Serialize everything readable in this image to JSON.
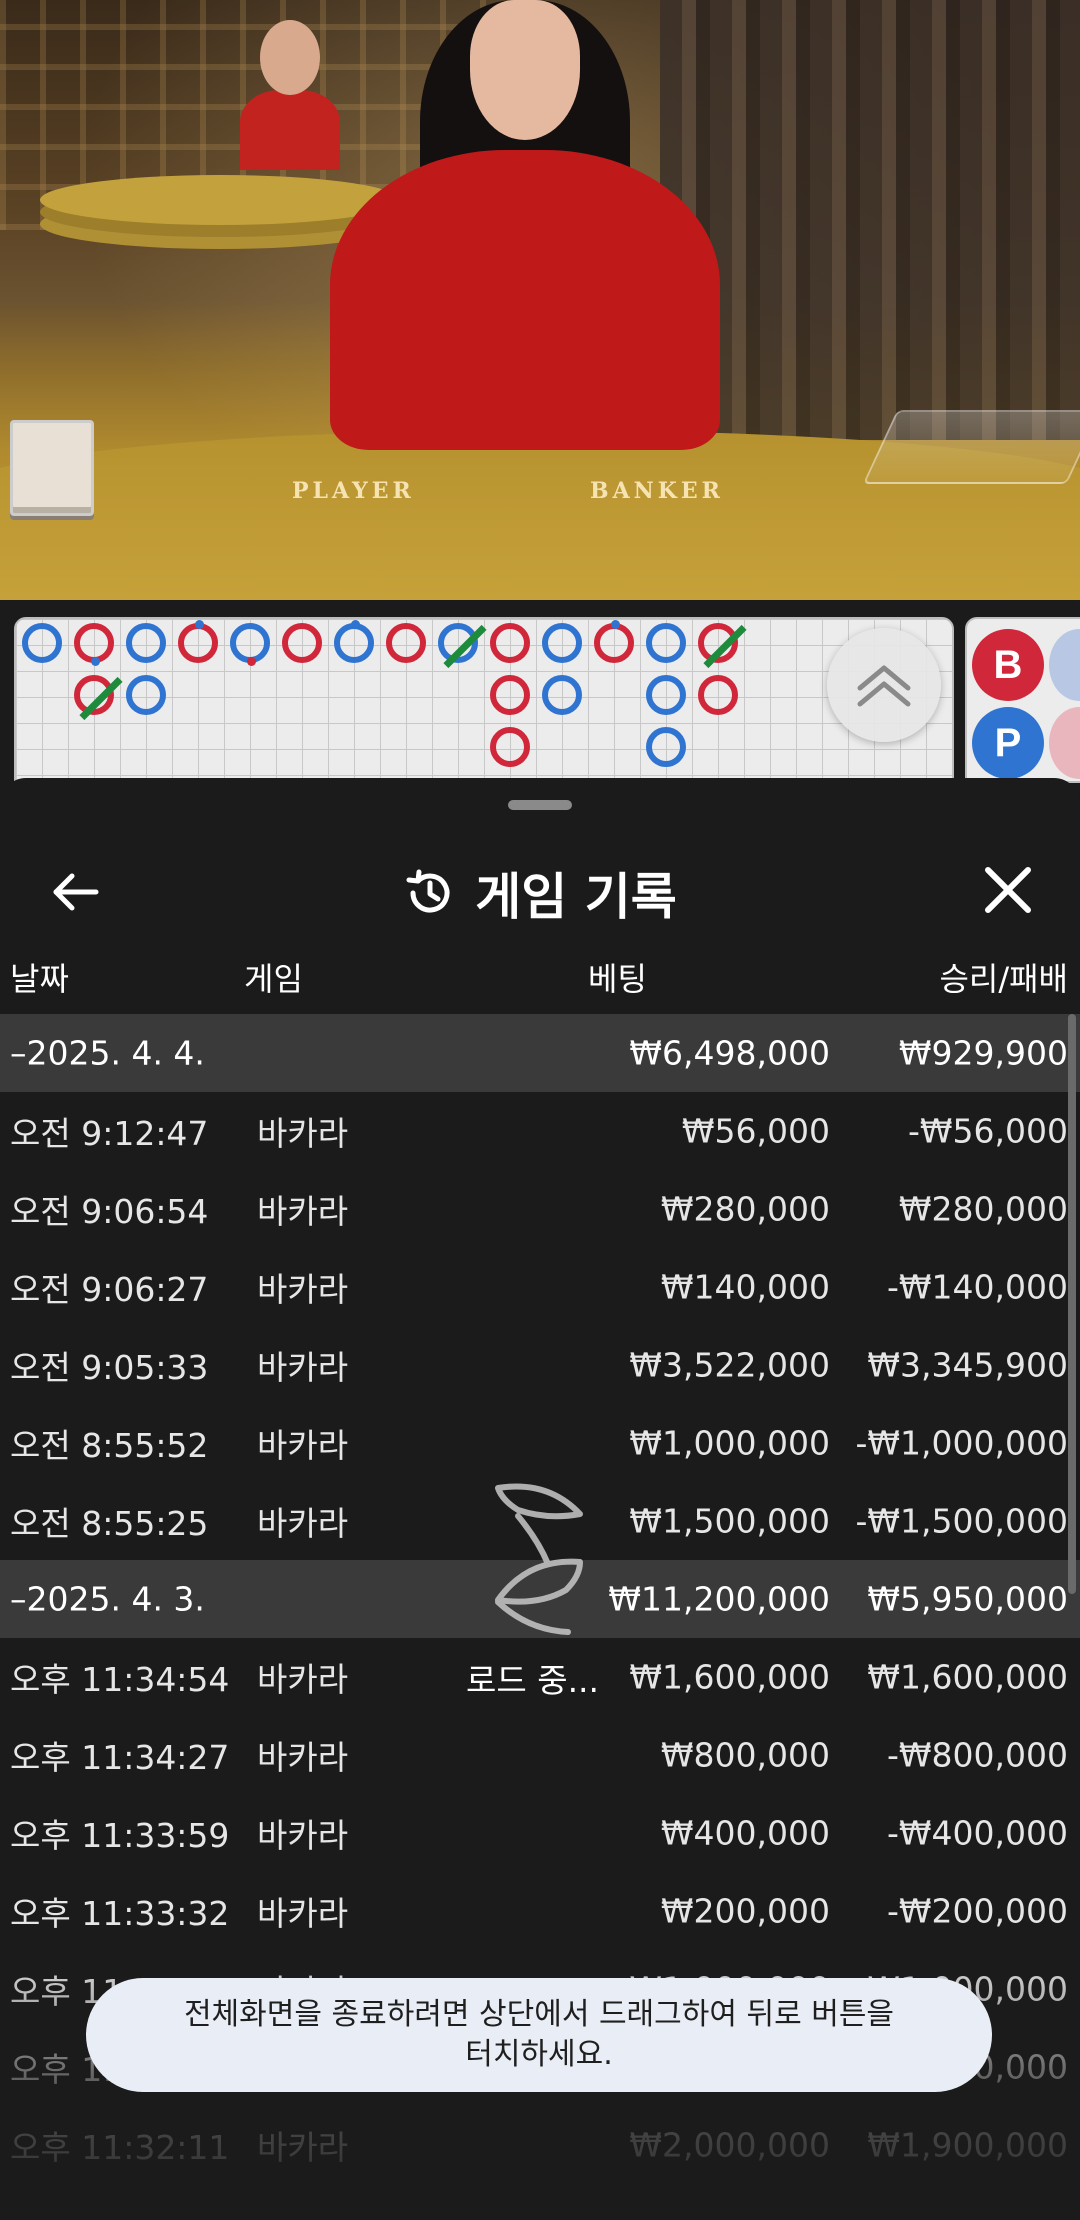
{
  "video": {
    "table_labels": {
      "player": "PLAYER",
      "banker": "BANKER"
    }
  },
  "road": {
    "beads": [
      {
        "col": 0,
        "row": 0,
        "color": "blue"
      },
      {
        "col": 1,
        "row": 0,
        "color": "red",
        "dot": "blue-bottom"
      },
      {
        "col": 1,
        "row": 1,
        "color": "red",
        "slash": true
      },
      {
        "col": 2,
        "row": 0,
        "color": "blue"
      },
      {
        "col": 2,
        "row": 1,
        "color": "blue"
      },
      {
        "col": 3,
        "row": 0,
        "color": "red",
        "dot": "blue"
      },
      {
        "col": 4,
        "row": 0,
        "color": "blue",
        "dot": "red-bottom"
      },
      {
        "col": 5,
        "row": 0,
        "color": "red"
      },
      {
        "col": 6,
        "row": 0,
        "color": "blue",
        "dot": "blue"
      },
      {
        "col": 7,
        "row": 0,
        "color": "red"
      },
      {
        "col": 8,
        "row": 0,
        "color": "blue",
        "slash": true
      },
      {
        "col": 9,
        "row": 0,
        "color": "red"
      },
      {
        "col": 9,
        "row": 1,
        "color": "red"
      },
      {
        "col": 9,
        "row": 2,
        "color": "red"
      },
      {
        "col": 10,
        "row": 0,
        "color": "blue"
      },
      {
        "col": 10,
        "row": 1,
        "color": "blue"
      },
      {
        "col": 11,
        "row": 0,
        "color": "red",
        "dot": "blue"
      },
      {
        "col": 12,
        "row": 0,
        "color": "blue"
      },
      {
        "col": 12,
        "row": 1,
        "color": "blue"
      },
      {
        "col": 12,
        "row": 2,
        "color": "blue"
      },
      {
        "col": 13,
        "row": 0,
        "color": "red",
        "slash": true
      },
      {
        "col": 13,
        "row": 1,
        "color": "red"
      }
    ],
    "side_buttons": {
      "banker": "B",
      "player": "P"
    }
  },
  "sheet": {
    "title": "게임 기록",
    "columns": {
      "date": "날짜",
      "game": "게임",
      "bet": "베팅",
      "winloss": "승리/패배"
    },
    "rows": [
      {
        "type": "group",
        "time": "–2025. 4. 4.",
        "game": "",
        "bet": "₩6,498,000",
        "win": "₩929,900"
      },
      {
        "type": "item",
        "time": "오전 9:12:47",
        "game": "바카라",
        "bet": "₩56,000",
        "win": "-₩56,000"
      },
      {
        "type": "item",
        "time": "오전 9:06:54",
        "game": "바카라",
        "bet": "₩280,000",
        "win": "₩280,000"
      },
      {
        "type": "item",
        "time": "오전 9:06:27",
        "game": "바카라",
        "bet": "₩140,000",
        "win": "-₩140,000"
      },
      {
        "type": "item",
        "time": "오전 9:05:33",
        "game": "바카라",
        "bet": "₩3,522,000",
        "win": "₩3,345,900"
      },
      {
        "type": "item",
        "time": "오전 8:55:52",
        "game": "바카라",
        "bet": "₩1,000,000",
        "win": "-₩1,000,000"
      },
      {
        "type": "item",
        "time": "오전 8:55:25",
        "game": "바카라",
        "bet": "₩1,500,000",
        "win": "-₩1,500,000"
      },
      {
        "type": "group",
        "time": "–2025. 4. 3.",
        "game": "",
        "bet": "₩11,200,000",
        "win": "₩5,950,000"
      },
      {
        "type": "item",
        "time": "오후 11:34:54",
        "game": "바카라",
        "bet": "₩1,600,000",
        "win": "₩1,600,000"
      },
      {
        "type": "item",
        "time": "오후 11:34:27",
        "game": "바카라",
        "bet": "₩800,000",
        "win": "-₩800,000"
      },
      {
        "type": "item",
        "time": "오후 11:33:59",
        "game": "바카라",
        "bet": "₩400,000",
        "win": "-₩400,000"
      },
      {
        "type": "item",
        "time": "오후 11:33:32",
        "game": "바카라",
        "bet": "₩200,000",
        "win": "-₩200,000"
      },
      {
        "type": "item",
        "time": "오후 11:33:05",
        "game": "바카라",
        "bet": "₩1,000,000",
        "win": "₩1,000,000"
      },
      {
        "type": "item",
        "time": "오후 11:32:39",
        "game": "바카라",
        "bet": "₩2,000,000",
        "win": "₩2,000,000"
      },
      {
        "type": "item",
        "time": "오후 11:32:11",
        "game": "바카라",
        "bet": "₩2,000,000",
        "win": "₩1,900,000"
      }
    ],
    "loading_text": "로드 중..."
  },
  "toast": {
    "line1": "전체화면을 종료하려면 상단에서 드래그하여 뒤로 버튼을",
    "line2": "터치하세요."
  }
}
